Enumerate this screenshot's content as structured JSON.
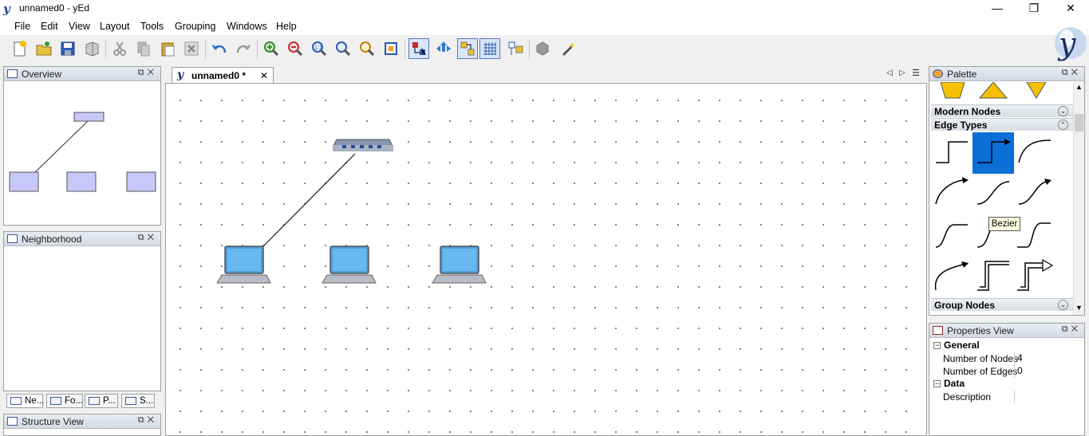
{
  "window": {
    "title": "unnamed0 - yEd",
    "minimize": "—",
    "maximize": "❐",
    "close": "✕"
  },
  "menu": [
    "File",
    "Edit",
    "View",
    "Layout",
    "Tools",
    "Grouping",
    "Windows",
    "Help"
  ],
  "panels": {
    "overview": {
      "title": "Overview"
    },
    "neighborhood": {
      "title": "Neighborhood"
    },
    "structure": {
      "title": "Structure View"
    },
    "bottom_tabs": [
      "Ne...",
      "Fo...",
      "P...",
      "S..."
    ],
    "palette": {
      "title": "Palette"
    },
    "properties": {
      "title": "Properties View"
    }
  },
  "document": {
    "tab_label": "unnamed0 *",
    "tab_close": "✕"
  },
  "palette": {
    "sections": [
      {
        "label": "Modern Nodes",
        "state": "collapsed"
      },
      {
        "label": "Edge Types",
        "state": "expanded"
      },
      {
        "label": "Group Nodes",
        "state": "collapsed"
      }
    ],
    "tooltip": "Bezier"
  },
  "properties": {
    "groups": [
      {
        "label": "General",
        "rows": [
          {
            "key": "Number of Nodes",
            "value": "4"
          },
          {
            "key": "Number of Edges",
            "value": "0"
          }
        ]
      },
      {
        "label": "Data",
        "rows": [
          {
            "key": "Description",
            "value": ""
          }
        ]
      }
    ],
    "expander": "−"
  },
  "colors": {
    "selection_blue": "#0a6fd6",
    "overview_node": "#c8c8f8",
    "laptop_screen": "#4a9fe0"
  }
}
